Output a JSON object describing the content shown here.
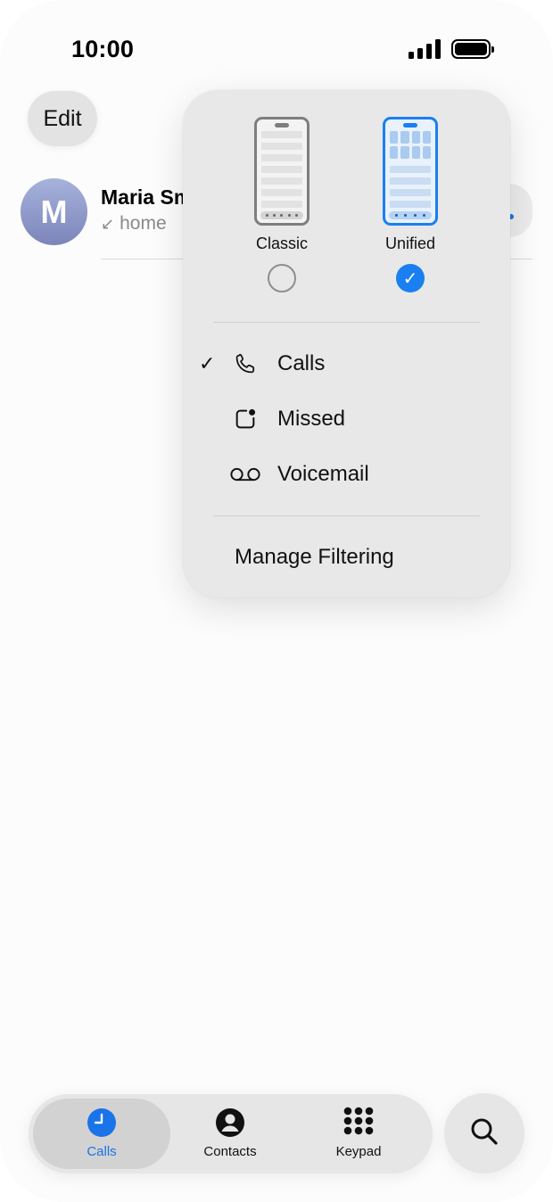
{
  "status_bar": {
    "time": "10:00"
  },
  "header": {
    "edit_label": "Edit"
  },
  "call": {
    "avatar_initial": "M",
    "name": "Maria Smith",
    "type": "home"
  },
  "menu": {
    "layouts": [
      {
        "label": "Classic",
        "selected": false
      },
      {
        "label": "Unified",
        "selected": true
      }
    ],
    "filters": [
      {
        "label": "Calls",
        "icon": "phone-icon",
        "checked": true
      },
      {
        "label": "Missed",
        "icon": "missed-badge-icon",
        "checked": false
      },
      {
        "label": "Voicemail",
        "icon": "voicemail-icon",
        "checked": false
      }
    ],
    "manage_label": "Manage Filtering"
  },
  "tabbar": {
    "tabs": [
      {
        "label": "Calls",
        "icon": "clock-icon",
        "active": true
      },
      {
        "label": "Contacts",
        "icon": "person-icon",
        "active": false
      },
      {
        "label": "Keypad",
        "icon": "keypad-icon",
        "active": false
      }
    ]
  },
  "colors": {
    "accent": "#1a7ff0",
    "tab_active": "#1a73e8"
  }
}
